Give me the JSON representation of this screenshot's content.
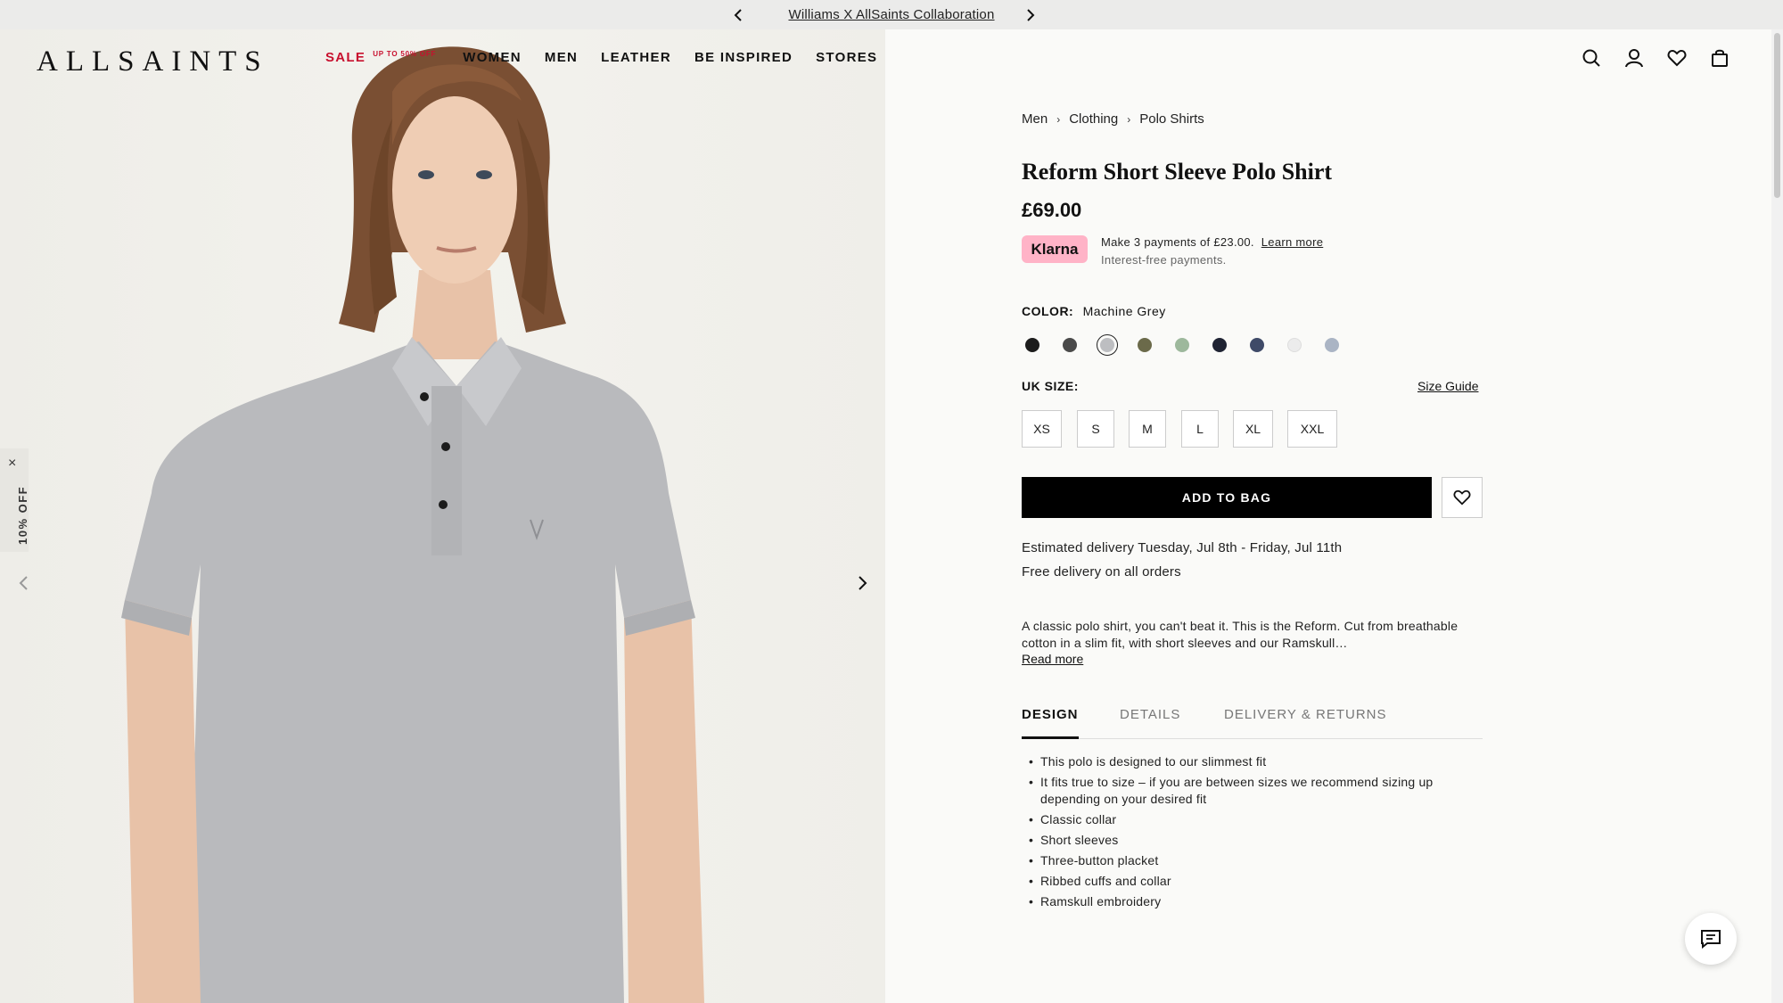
{
  "banner": {
    "promo_text": "Williams X AllSaints Collaboration",
    "prev_icon": "chevron-left-icon",
    "next_icon": "chevron-right-icon"
  },
  "header": {
    "logo": "ALLSAINTS",
    "nav": {
      "sale": "SALE",
      "sale_sub": "UP TO 50% OFF",
      "women": "WOMEN",
      "men": "MEN",
      "leather": "LEATHER",
      "be_inspired": "BE INSPIRED",
      "stores": "STORES"
    },
    "icons": [
      "search-icon",
      "account-icon",
      "heart-icon",
      "bag-icon"
    ]
  },
  "side_tab": {
    "close": "×",
    "label": "10% OFF"
  },
  "gallery": {
    "image_alt": "Model wearing grey polo shirt",
    "prev_icon": "chevron-left-icon",
    "next_icon": "chevron-right-icon"
  },
  "product": {
    "breadcrumb": [
      "Men",
      "Clothing",
      "Polo Shirts"
    ],
    "title": "Reform Short Sleeve Polo Shirt",
    "price": "£69.00",
    "klarna": {
      "badge": "Klarna",
      "text": "Make 3 payments of £23.00.",
      "learn_more": "Learn more",
      "sub": "Interest-free payments."
    },
    "color": {
      "label": "COLOR:",
      "value": "Machine Grey",
      "swatches": [
        "#1c1c1c",
        "#4a4a4a",
        "#bdbec1",
        "#6b6a4a",
        "#9db89c",
        "#1f2333",
        "#3f4a68",
        "#ececec",
        "#aab4c4"
      ],
      "selected_index": 2
    },
    "size": {
      "label": "UK SIZE:",
      "guide": "Size Guide",
      "options": [
        "XS",
        "S",
        "M",
        "L",
        "XL",
        "XXL"
      ]
    },
    "add_to_bag": "ADD TO BAG",
    "delivery_estimate": "Estimated delivery Tuesday, Jul 8th - Friday, Jul 11th",
    "delivery_free": "Free delivery on all orders",
    "description": "A classic polo shirt, you can't beat it. This is the Reform. Cut from breathable cotton in a slim fit, with short sleeves and our Ramskull…",
    "read_more": "Read more",
    "tabs": [
      "DESIGN",
      "DETAILS",
      "DELIVERY & RETURNS"
    ],
    "design_points": [
      "This polo is designed to our slimmest fit",
      "It fits true to size – if you are between sizes we recommend sizing up depending on your desired fit",
      "Classic collar",
      "Short sleeves",
      "Three-button placket",
      "Ribbed cuffs and collar",
      "Ramskull embroidery"
    ]
  },
  "chat": {
    "icon": "chat-icon"
  },
  "colors": {
    "sale_red": "#c8102e",
    "klarna_pink": "#ffb3c7",
    "primary": "#000000"
  }
}
